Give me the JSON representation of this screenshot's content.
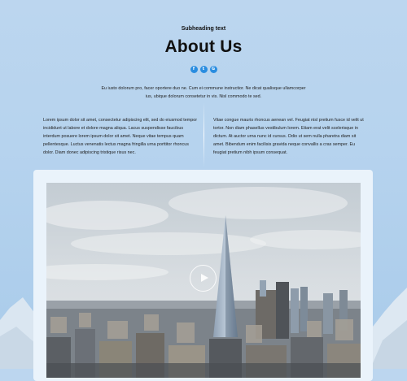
{
  "hero": {
    "subheading": "Subheading text",
    "title": "About Us",
    "intro": "Eu iusto dolorum pro, facer oportere duo ne. Cum ei commune instructior. Ne dicat qualisque ullamcorper ius, ubique dolorum consetetur in vis. Nisl commodo te sed."
  },
  "socials": [
    {
      "icon": "facebook-icon",
      "glyph": "f"
    },
    {
      "icon": "twitter-icon",
      "glyph": "t"
    },
    {
      "icon": "google-plus-icon",
      "glyph": "G"
    }
  ],
  "columns": {
    "left": "Lorem ipsum dolor sit amet, consectetur adipiscing elit, sed do eiusmod tempor incididunt ut labore et dolore magna aliqua. Lacus suspendisse faucibus interdum posuere lorem ipsum dolor sit amet. Neque vitae tempus quam pellentesque. Luctus venenatis lectus magna fringilla urna porttitor rhoncus dolor. Diam donec adipiscing tristique risus nec.",
    "right": "Vitae congue mauris rhoncus aenean vel. Feugiat nisl pretium fusce id velit ut tortor. Non diam phasellus vestibulum lorem. Etiam erat velit scelerisque in dictum. At auctor urna nunc id cursus. Odio ut sem nulla pharetra diam sit amet. Bibendum enim facilisis gravida neque convallis a cras semper. Eu feugiat pretium nibh ipsum consequat."
  },
  "colors": {
    "accent": "#2a8de0",
    "background": "#b6d3ee",
    "card": "#eaf3fb"
  }
}
